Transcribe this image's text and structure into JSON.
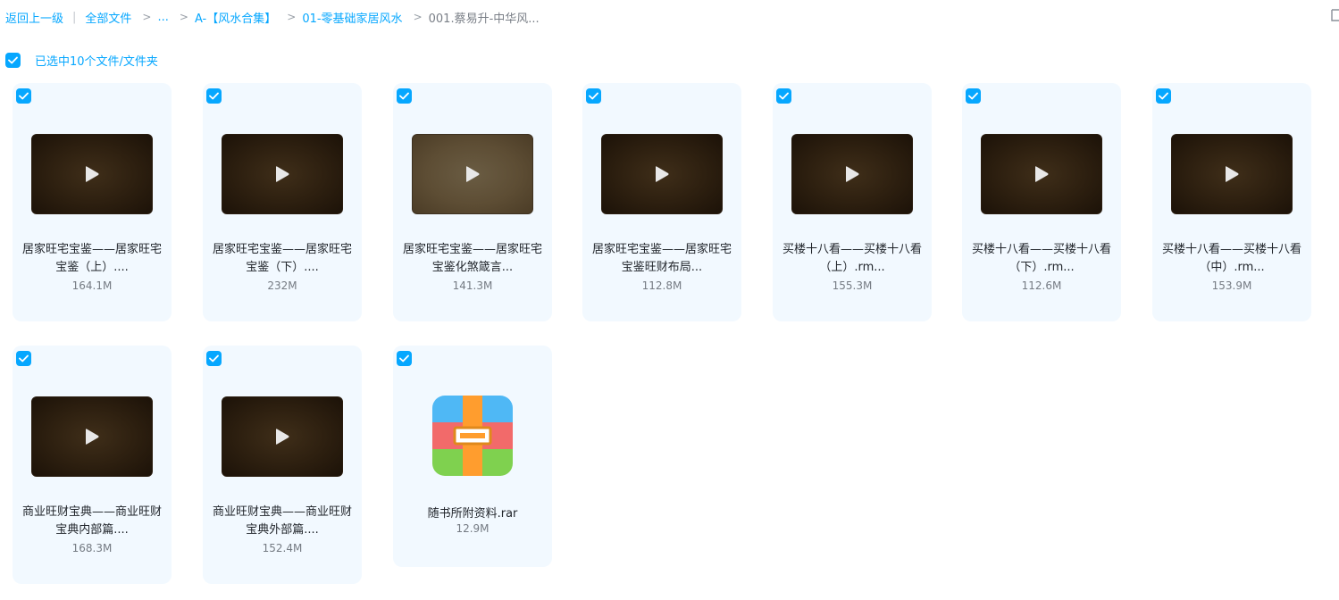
{
  "breadcrumb": {
    "back_label": "返回上一级",
    "all_files_label": "全部文件",
    "ellipsis": "...",
    "crumb_1": "A-【风水合集】",
    "crumb_2": "01-零基础家居风水",
    "current": "001.蔡易升-中华风..."
  },
  "selection": {
    "label": "已选中10个文件/文件夹"
  },
  "files": [
    {
      "name": "居家旺宅宝鉴——居家旺宅宝鉴（上）....",
      "size": "164.1M",
      "type": "video",
      "thumb": "dark"
    },
    {
      "name": "居家旺宅宝鉴——居家旺宅宝鉴（下）....",
      "size": "232M",
      "type": "video",
      "thumb": "dark"
    },
    {
      "name": "居家旺宅宝鉴——居家旺宅宝鉴化煞箴言...",
      "size": "141.3M",
      "type": "video",
      "thumb": "light"
    },
    {
      "name": "居家旺宅宝鉴——居家旺宅宝鉴旺财布局...",
      "size": "112.8M",
      "type": "video",
      "thumb": "dark"
    },
    {
      "name": "买楼十八看——买楼十八看（上）.rm...",
      "size": "155.3M",
      "type": "video",
      "thumb": "dark"
    },
    {
      "name": "买楼十八看——买楼十八看（下）.rm...",
      "size": "112.6M",
      "type": "video",
      "thumb": "dark"
    },
    {
      "name": "买楼十八看——买楼十八看（中）.rm...",
      "size": "153.9M",
      "type": "video",
      "thumb": "dark"
    },
    {
      "name": "商业旺财宝典——商业旺财宝典内部篇....",
      "size": "168.3M",
      "type": "video",
      "thumb": "dark"
    },
    {
      "name": "商业旺财宝典——商业旺财宝典外部篇....",
      "size": "152.4M",
      "type": "video",
      "thumb": "dark"
    },
    {
      "name": "随书所附资料.rar",
      "size": "12.9M",
      "type": "archive",
      "icon": "rar-archive-icon"
    }
  ],
  "colors": {
    "accent": "#06a7ff",
    "card_bg": "#f2f9ff"
  }
}
